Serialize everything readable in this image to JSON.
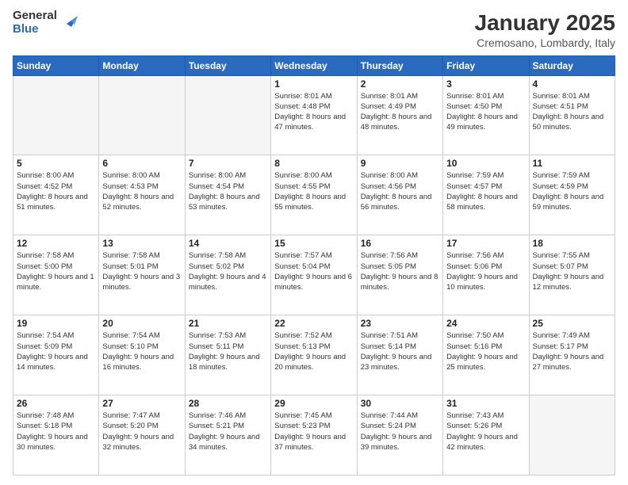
{
  "header": {
    "logo_general": "General",
    "logo_blue": "Blue",
    "title": "January 2025",
    "subtitle": "Cremosano, Lombardy, Italy"
  },
  "weekdays": [
    "Sunday",
    "Monday",
    "Tuesday",
    "Wednesday",
    "Thursday",
    "Friday",
    "Saturday"
  ],
  "weeks": [
    [
      {
        "day": "",
        "sunrise": "",
        "sunset": "",
        "daylight": "",
        "empty": true
      },
      {
        "day": "",
        "sunrise": "",
        "sunset": "",
        "daylight": "",
        "empty": true
      },
      {
        "day": "",
        "sunrise": "",
        "sunset": "",
        "daylight": "",
        "empty": true
      },
      {
        "day": "1",
        "sunrise": "Sunrise: 8:01 AM",
        "sunset": "Sunset: 4:48 PM",
        "daylight": "Daylight: 8 hours and 47 minutes.",
        "empty": false
      },
      {
        "day": "2",
        "sunrise": "Sunrise: 8:01 AM",
        "sunset": "Sunset: 4:49 PM",
        "daylight": "Daylight: 8 hours and 48 minutes.",
        "empty": false
      },
      {
        "day": "3",
        "sunrise": "Sunrise: 8:01 AM",
        "sunset": "Sunset: 4:50 PM",
        "daylight": "Daylight: 8 hours and 49 minutes.",
        "empty": false
      },
      {
        "day": "4",
        "sunrise": "Sunrise: 8:01 AM",
        "sunset": "Sunset: 4:51 PM",
        "daylight": "Daylight: 8 hours and 50 minutes.",
        "empty": false
      }
    ],
    [
      {
        "day": "5",
        "sunrise": "Sunrise: 8:00 AM",
        "sunset": "Sunset: 4:52 PM",
        "daylight": "Daylight: 8 hours and 51 minutes.",
        "empty": false
      },
      {
        "day": "6",
        "sunrise": "Sunrise: 8:00 AM",
        "sunset": "Sunset: 4:53 PM",
        "daylight": "Daylight: 8 hours and 52 minutes.",
        "empty": false
      },
      {
        "day": "7",
        "sunrise": "Sunrise: 8:00 AM",
        "sunset": "Sunset: 4:54 PM",
        "daylight": "Daylight: 8 hours and 53 minutes.",
        "empty": false
      },
      {
        "day": "8",
        "sunrise": "Sunrise: 8:00 AM",
        "sunset": "Sunset: 4:55 PM",
        "daylight": "Daylight: 8 hours and 55 minutes.",
        "empty": false
      },
      {
        "day": "9",
        "sunrise": "Sunrise: 8:00 AM",
        "sunset": "Sunset: 4:56 PM",
        "daylight": "Daylight: 8 hours and 56 minutes.",
        "empty": false
      },
      {
        "day": "10",
        "sunrise": "Sunrise: 7:59 AM",
        "sunset": "Sunset: 4:57 PM",
        "daylight": "Daylight: 8 hours and 58 minutes.",
        "empty": false
      },
      {
        "day": "11",
        "sunrise": "Sunrise: 7:59 AM",
        "sunset": "Sunset: 4:59 PM",
        "daylight": "Daylight: 8 hours and 59 minutes.",
        "empty": false
      }
    ],
    [
      {
        "day": "12",
        "sunrise": "Sunrise: 7:58 AM",
        "sunset": "Sunset: 5:00 PM",
        "daylight": "Daylight: 9 hours and 1 minute.",
        "empty": false
      },
      {
        "day": "13",
        "sunrise": "Sunrise: 7:58 AM",
        "sunset": "Sunset: 5:01 PM",
        "daylight": "Daylight: 9 hours and 3 minutes.",
        "empty": false
      },
      {
        "day": "14",
        "sunrise": "Sunrise: 7:58 AM",
        "sunset": "Sunset: 5:02 PM",
        "daylight": "Daylight: 9 hours and 4 minutes.",
        "empty": false
      },
      {
        "day": "15",
        "sunrise": "Sunrise: 7:57 AM",
        "sunset": "Sunset: 5:04 PM",
        "daylight": "Daylight: 9 hours and 6 minutes.",
        "empty": false
      },
      {
        "day": "16",
        "sunrise": "Sunrise: 7:56 AM",
        "sunset": "Sunset: 5:05 PM",
        "daylight": "Daylight: 9 hours and 8 minutes.",
        "empty": false
      },
      {
        "day": "17",
        "sunrise": "Sunrise: 7:56 AM",
        "sunset": "Sunset: 5:06 PM",
        "daylight": "Daylight: 9 hours and 10 minutes.",
        "empty": false
      },
      {
        "day": "18",
        "sunrise": "Sunrise: 7:55 AM",
        "sunset": "Sunset: 5:07 PM",
        "daylight": "Daylight: 9 hours and 12 minutes.",
        "empty": false
      }
    ],
    [
      {
        "day": "19",
        "sunrise": "Sunrise: 7:54 AM",
        "sunset": "Sunset: 5:09 PM",
        "daylight": "Daylight: 9 hours and 14 minutes.",
        "empty": false
      },
      {
        "day": "20",
        "sunrise": "Sunrise: 7:54 AM",
        "sunset": "Sunset: 5:10 PM",
        "daylight": "Daylight: 9 hours and 16 minutes.",
        "empty": false
      },
      {
        "day": "21",
        "sunrise": "Sunrise: 7:53 AM",
        "sunset": "Sunset: 5:11 PM",
        "daylight": "Daylight: 9 hours and 18 minutes.",
        "empty": false
      },
      {
        "day": "22",
        "sunrise": "Sunrise: 7:52 AM",
        "sunset": "Sunset: 5:13 PM",
        "daylight": "Daylight: 9 hours and 20 minutes.",
        "empty": false
      },
      {
        "day": "23",
        "sunrise": "Sunrise: 7:51 AM",
        "sunset": "Sunset: 5:14 PM",
        "daylight": "Daylight: 9 hours and 23 minutes.",
        "empty": false
      },
      {
        "day": "24",
        "sunrise": "Sunrise: 7:50 AM",
        "sunset": "Sunset: 5:16 PM",
        "daylight": "Daylight: 9 hours and 25 minutes.",
        "empty": false
      },
      {
        "day": "25",
        "sunrise": "Sunrise: 7:49 AM",
        "sunset": "Sunset: 5:17 PM",
        "daylight": "Daylight: 9 hours and 27 minutes.",
        "empty": false
      }
    ],
    [
      {
        "day": "26",
        "sunrise": "Sunrise: 7:48 AM",
        "sunset": "Sunset: 5:18 PM",
        "daylight": "Daylight: 9 hours and 30 minutes.",
        "empty": false
      },
      {
        "day": "27",
        "sunrise": "Sunrise: 7:47 AM",
        "sunset": "Sunset: 5:20 PM",
        "daylight": "Daylight: 9 hours and 32 minutes.",
        "empty": false
      },
      {
        "day": "28",
        "sunrise": "Sunrise: 7:46 AM",
        "sunset": "Sunset: 5:21 PM",
        "daylight": "Daylight: 9 hours and 34 minutes.",
        "empty": false
      },
      {
        "day": "29",
        "sunrise": "Sunrise: 7:45 AM",
        "sunset": "Sunset: 5:23 PM",
        "daylight": "Daylight: 9 hours and 37 minutes.",
        "empty": false
      },
      {
        "day": "30",
        "sunrise": "Sunrise: 7:44 AM",
        "sunset": "Sunset: 5:24 PM",
        "daylight": "Daylight: 9 hours and 39 minutes.",
        "empty": false
      },
      {
        "day": "31",
        "sunrise": "Sunrise: 7:43 AM",
        "sunset": "Sunset: 5:26 PM",
        "daylight": "Daylight: 9 hours and 42 minutes.",
        "empty": false
      },
      {
        "day": "",
        "sunrise": "",
        "sunset": "",
        "daylight": "",
        "empty": true
      }
    ]
  ]
}
